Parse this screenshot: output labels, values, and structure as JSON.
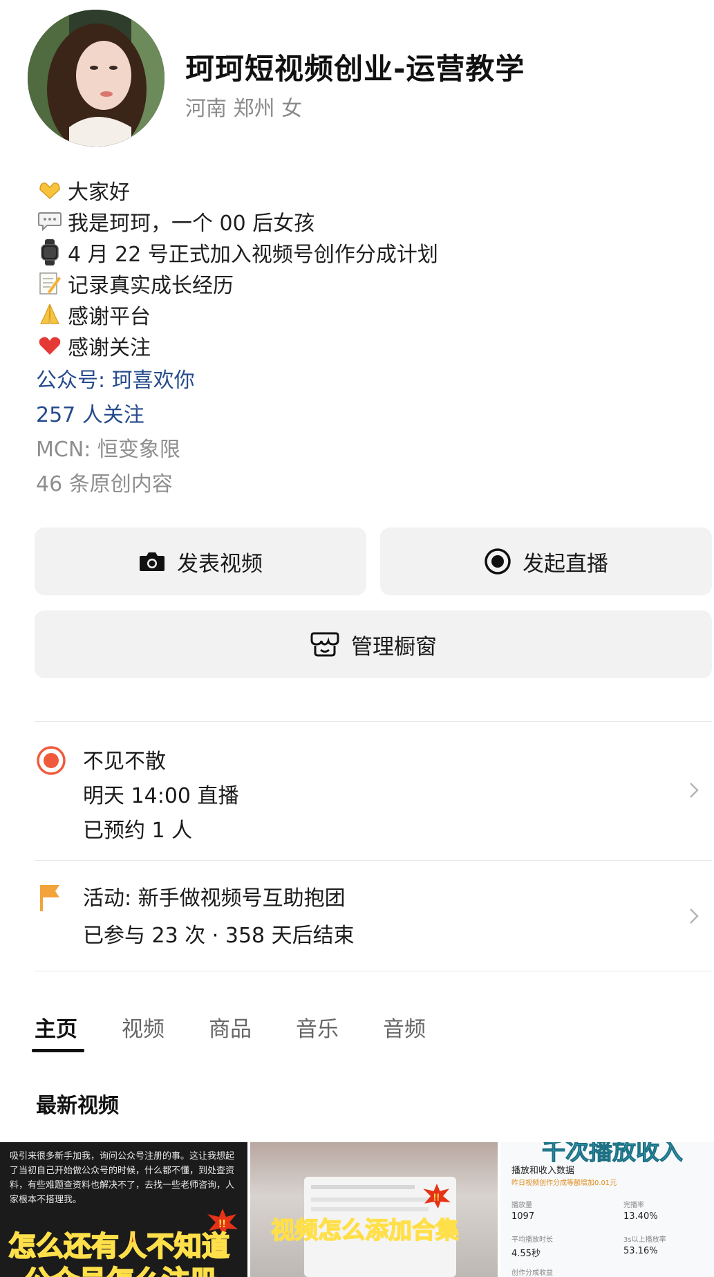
{
  "profile": {
    "name": "珂珂短视频创业-运营教学",
    "location": "河南 郑州 女",
    "avatar_icon": "avatar-photo"
  },
  "bio": {
    "lines": [
      {
        "emoji": "heart-hands-icon",
        "text": "大家好"
      },
      {
        "emoji": "speech-bubble-icon",
        "text": "我是珂珂，一个 00 后女孩"
      },
      {
        "emoji": "watch-icon",
        "text": "4 月 22 号正式加入视频号创作分成计划"
      },
      {
        "emoji": "memo-icon",
        "text": "记录真实成长经历"
      },
      {
        "emoji": "folded-hands-icon",
        "text": "感谢平台"
      },
      {
        "emoji": "red-heart-icon",
        "text": "感谢关注"
      }
    ],
    "official_account": "公众号: 珂喜欢你",
    "followers": "257 人关注",
    "mcn": "MCN: 恒变象限",
    "original_count": "46 条原创内容"
  },
  "actions": {
    "post_video": "发表视频",
    "start_live": "发起直播",
    "manage_shop": "管理橱窗"
  },
  "live_reservation": {
    "title": "不见不散",
    "time": "明天 14:00 直播",
    "reserved": "已预约 1 人"
  },
  "activity": {
    "title": "活动: 新手做视频号互助抱团",
    "detail": "已参与 23 次 · 358 天后结束"
  },
  "tabs": [
    "主页",
    "视频",
    "商品",
    "音乐",
    "音频"
  ],
  "active_tab": "主页",
  "latest_videos": {
    "title": "最新视频",
    "thumbs": [
      {
        "caption": "吸引来很多新手加我，询问公众号注册的事。这让我想起了当初自己开始做公众号的时候，什么都不懂，到处查资料，有些难题查资料也解决不了，去找一些老师咨询，人家根本不搭理我。",
        "headline": "怎么还有人不知道",
        "headline2": "公众号怎么注册"
      },
      {
        "headline": "视频怎么添加合集"
      },
      {
        "banner": "千次播放收入",
        "panel_title": "播放和收入数据",
        "panel_sub": "昨日视频创作分成等额增加0.01元",
        "stats": [
          {
            "label": "播放量",
            "value": "1097"
          },
          {
            "label": "完播率",
            "value": "13.40%"
          },
          {
            "label": "平均播放时长",
            "value": "4.55秒"
          },
          {
            "label": "3s以上播放率",
            "value": "53.16%"
          }
        ],
        "footer": "创作分成收益"
      }
    ]
  },
  "colors": {
    "link": "#264b8c",
    "grey_text": "#8e8e8e",
    "button_bg": "#f2f2f2",
    "live_red": "#f05a3c",
    "flag_orange": "#f2a33a"
  }
}
